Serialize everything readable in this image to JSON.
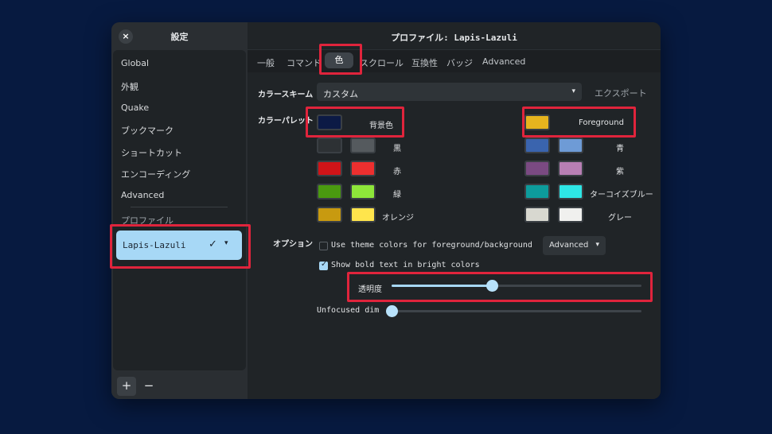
{
  "sidebar": {
    "close_icon": "×",
    "title": "設定",
    "items": [
      "Global",
      "外観",
      "Quake",
      "ブックマーク",
      "ショートカット",
      "エンコーディング",
      "Advanced"
    ],
    "section_label": "プロファイル",
    "profile": {
      "name": "Lapis-Lazuli",
      "check_icon": "✓",
      "caret_icon": "▾"
    },
    "add_label": "+",
    "remove_label": "−"
  },
  "main": {
    "title": "プロファイル: Lapis-Lazuli",
    "tabs": [
      "一般",
      "コマンド",
      "色",
      "スクロール",
      "互換性",
      "バッジ",
      "Advanced"
    ],
    "active_tab_index": 2
  },
  "scheme": {
    "label": "カラースキーム",
    "value": "カスタム",
    "caret": "▾",
    "export_label": "エクスポート"
  },
  "palette": {
    "label": "カラーパレット",
    "background": {
      "label": "背景色",
      "color": "#0c1a45"
    },
    "foreground": {
      "label": "Foreground",
      "color": "#e6b41e"
    },
    "left": [
      {
        "label": "黒",
        "normal": "#2d3134",
        "bright": "#555a5e"
      },
      {
        "label": "赤",
        "normal": "#d01418",
        "bright": "#ec2f2f"
      },
      {
        "label": "緑",
        "normal": "#4a9a10",
        "bright": "#8ee63a"
      },
      {
        "label": "オレンジ",
        "normal": "#c89a10",
        "bright": "#ffe54c"
      }
    ],
    "right": [
      {
        "label": "青",
        "normal": "#3a64ae",
        "bright": "#6e9bd6"
      },
      {
        "label": "紫",
        "normal": "#7a4a82",
        "bright": "#b87fb4"
      },
      {
        "label": "ターコイズブルー",
        "normal": "#0d9c9c",
        "bright": "#2ee6e6"
      },
      {
        "label": "グレー",
        "normal": "#d8d8d0",
        "bright": "#f0f0ee"
      }
    ]
  },
  "options": {
    "label": "オプション",
    "theme_colors": {
      "label": "Use theme colors for foreground/background",
      "checked": false
    },
    "advanced_select": {
      "value": "Advanced",
      "caret": "▾"
    },
    "bold_bright": {
      "label": "Show bold text in bright colors",
      "checked": true
    },
    "transparency": {
      "label": "透明度",
      "value": 0.4
    },
    "unfocused_dim": {
      "label": "Unfocused dim",
      "value": 0.0
    }
  },
  "colors": {
    "accent": "#a7d8f6",
    "highlight": "#e0243c",
    "desktop": "#071a40"
  }
}
